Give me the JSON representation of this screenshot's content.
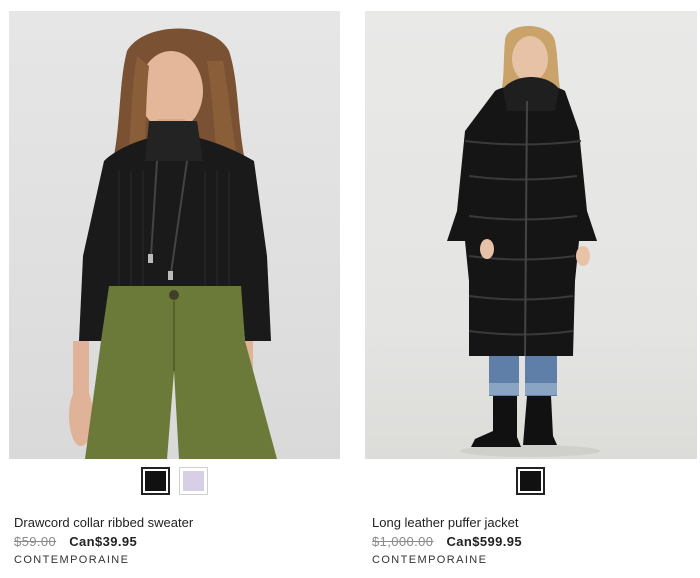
{
  "products": [
    {
      "name": "Drawcord collar ribbed sweater",
      "old_price": "$59.00",
      "sale_price": "Can$39.95",
      "brand": "CONTEMPORAINE",
      "swatches": [
        {
          "color": "#111111",
          "selected": true
        },
        {
          "color": "#d7cfe6",
          "selected": false
        }
      ]
    },
    {
      "name": "Long leather puffer jacket",
      "old_price": "$1,000.00",
      "sale_price": "Can$599.95",
      "brand": "CONTEMPORAINE",
      "swatches": [
        {
          "color": "#111111",
          "selected": true
        }
      ]
    }
  ]
}
